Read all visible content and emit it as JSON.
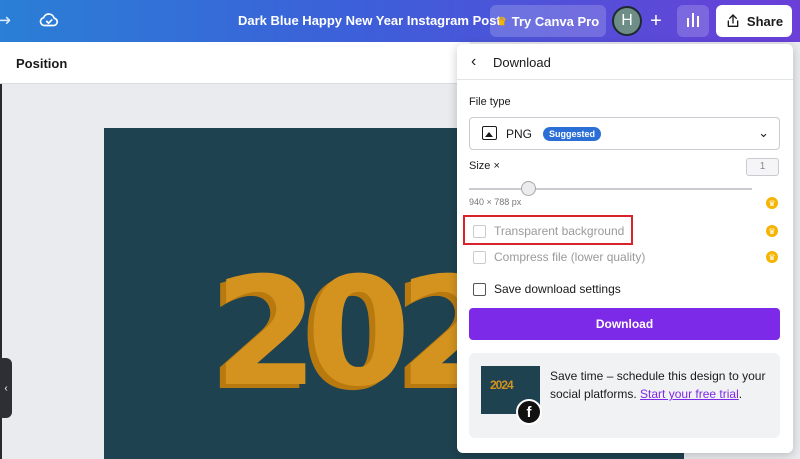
{
  "topbar": {
    "doc_title": "Dark Blue Happy New Year Instagram Post",
    "try_pro_label": "Try Canva Pro",
    "avatar_initial": "H",
    "share_label": "Share",
    "icons": [
      "redo-arrow-icon",
      "cloud-check-icon",
      "crown-icon",
      "plus-icon",
      "insights-icon",
      "share-icon"
    ]
  },
  "editor": {
    "position_label": "Position",
    "design_text": "202"
  },
  "download": {
    "title": "Download",
    "file_type_label": "File type",
    "file_type_value": "PNG",
    "suggested_badge": "Suggested",
    "size_label": "Size ×",
    "size_value": "1",
    "dimensions": "940 × 788 px",
    "options": [
      {
        "label": "Transparent background",
        "checked": false,
        "enabled": false,
        "pro": true
      },
      {
        "label": "Compress file (lower quality)",
        "checked": false,
        "enabled": false,
        "pro": true
      },
      {
        "label": "Save download settings",
        "checked": false,
        "enabled": true,
        "pro": false
      }
    ],
    "button_label": "Download",
    "promo": {
      "thumb_text": "2024",
      "text": "Save time – schedule this design to your social platforms.",
      "link_text": "Start your free trial",
      "suffix": "."
    }
  },
  "colors": {
    "accent": "#7d2ae8",
    "highlight": "#d9232c",
    "design_bg": "#1f4250",
    "year_gold": "#d4931e"
  }
}
